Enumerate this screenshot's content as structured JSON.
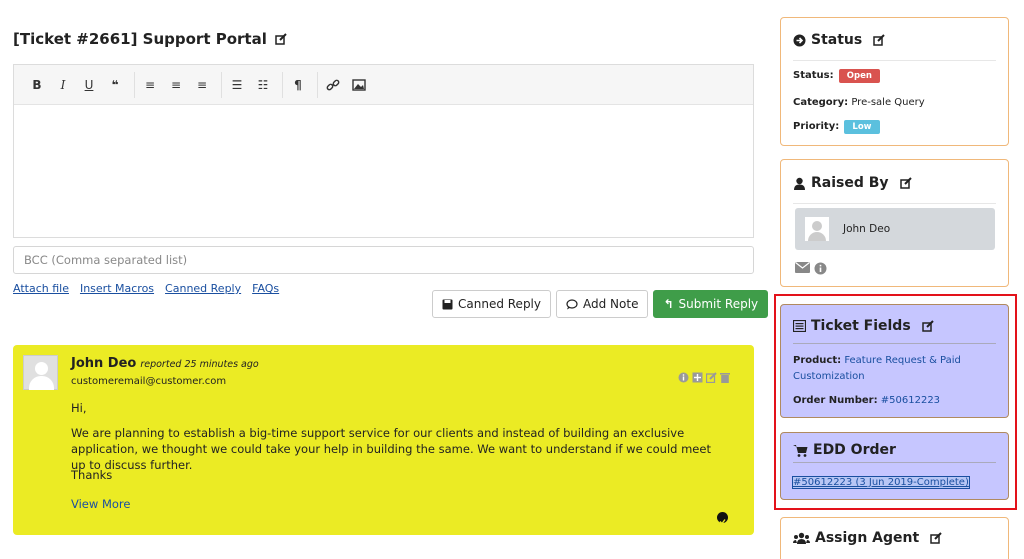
{
  "ticket": {
    "title": "[Ticket #2661] Support Portal"
  },
  "editor": {
    "toolbar": [
      "B",
      "I",
      "U",
      "66",
      "align-left",
      "align-center",
      "align-right",
      "bulleted-list",
      "numbered-list",
      "paragraph",
      "link",
      "image"
    ],
    "bcc_placeholder": "BCC (Comma separated list)"
  },
  "links": [
    "Attach file",
    "Insert Macros",
    "Canned Reply",
    "FAQs"
  ],
  "buttons": {
    "canned": "Canned Reply",
    "note": "Add Note",
    "submit": "Submit Reply"
  },
  "thread": {
    "author": "John Deo",
    "reported": "reported 25 minutes ago",
    "email": "customeremail@customer.com",
    "greeting": "Hi,",
    "body": "We are planning to establish a big-time support service for our clients and instead of building an exclusive application, we thought we could take your help in building the same. We want to understand if we could meet up to discuss further.",
    "signoff": "Thanks",
    "view_more": "View More"
  },
  "status": {
    "title": "Status",
    "status_label": "Status:",
    "status_value": "Open",
    "category_label": "Category:",
    "category_value": "Pre-sale Query",
    "priority_label": "Priority:",
    "priority_value": "Low"
  },
  "raised_by": {
    "title": "Raised By",
    "name": "John Deo"
  },
  "ticket_fields": {
    "title": "Ticket Fields",
    "product_label": "Product:",
    "product_value": "Feature Request & Paid Customization",
    "order_label": "Order Number:",
    "order_value": "#50612223"
  },
  "edd_order": {
    "title": "EDD Order",
    "order_link": "#50612223 (3 Jun 2019-Complete)"
  },
  "assign_agent": {
    "title": "Assign Agent"
  },
  "colors": {
    "open": "#d9534f",
    "low": "#5bc0de",
    "submit": "#3f9d49",
    "thread_bg": "#ebeb24",
    "highlight": "#e3121a"
  }
}
